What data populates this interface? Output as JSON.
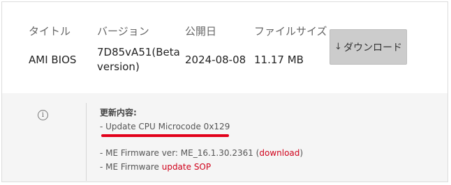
{
  "headers": {
    "title": "タイトル",
    "version": "バージョン",
    "date": "公開日",
    "size": "ファイルサイズ"
  },
  "row": {
    "title": "AMI BIOS",
    "version_line1": "7D85vA51(Beta",
    "version_line2": "version)",
    "date": "2024-08-08",
    "size": "11.17 MB"
  },
  "download_button": {
    "icon": "download-arrow-icon",
    "label": "ダウンロード"
  },
  "notes": {
    "title": "更新内容:",
    "line1": "- Update CPU Microcode 0x129",
    "line2_prefix": "- ME Firmware ver: ME_16.1.30.2361 (",
    "line2_link": "download",
    "line2_suffix": ")",
    "line3_prefix": "- ME Firmware ",
    "line3_link": "update SOP"
  },
  "colors": {
    "link": "#d0021b",
    "highlight_underline": "#e2001a",
    "button_bg": "#cccccc",
    "notes_bg": "#f5f5f5"
  },
  "icons": {
    "info": "info-icon"
  }
}
